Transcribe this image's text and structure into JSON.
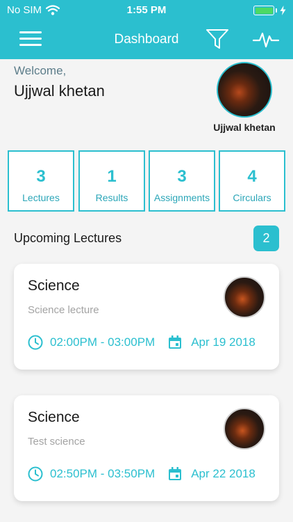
{
  "status_bar": {
    "carrier": "No SIM",
    "time": "1:55 PM"
  },
  "nav": {
    "title": "Dashboard"
  },
  "profile": {
    "greeting": "Welcome,",
    "name": "Ujjwal khetan",
    "avatar_caption": "Ujjwal khetan"
  },
  "stats": [
    {
      "value": "3",
      "label": "Lectures"
    },
    {
      "value": "1",
      "label": "Results"
    },
    {
      "value": "3",
      "label": "Assignments"
    },
    {
      "value": "4",
      "label": "Circulars"
    }
  ],
  "upcoming": {
    "title": "Upcoming Lectures",
    "count": "2",
    "lectures": [
      {
        "subject": "Science",
        "description": "Science lecture",
        "time": "02:00PM - 03:00PM",
        "date": "Apr 19 2018"
      },
      {
        "subject": "Science",
        "description": "Test science",
        "time": "02:50PM - 03:50PM",
        "date": "Apr 22 2018"
      }
    ]
  },
  "colors": {
    "accent": "#2bbfcf",
    "battery": "#4cd964",
    "muted": "#a3a3a3"
  },
  "icons": [
    "wifi-icon",
    "charging-icon",
    "menu-icon",
    "filter-icon",
    "activity-icon",
    "clock-icon",
    "calendar-icon"
  ]
}
